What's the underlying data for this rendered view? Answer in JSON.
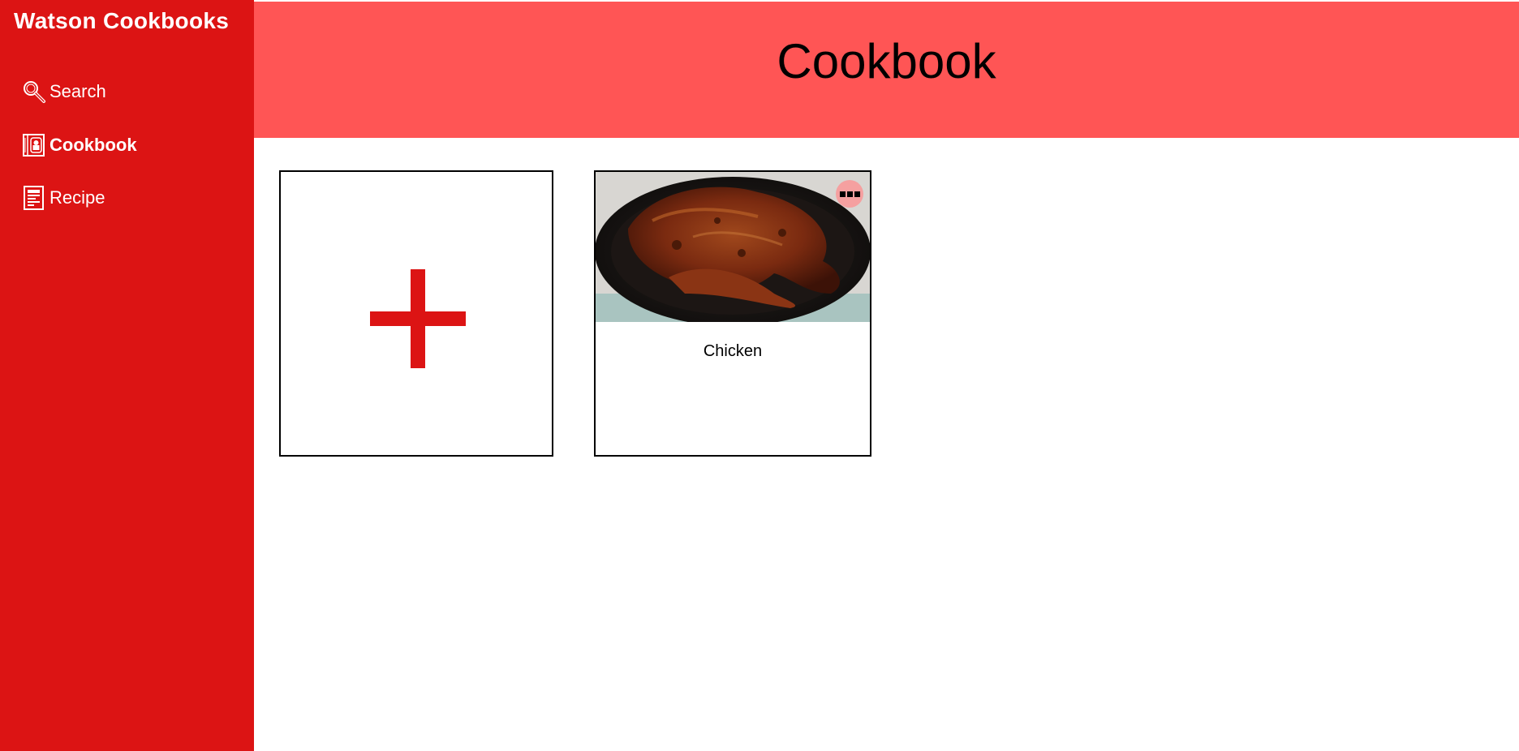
{
  "sidebar": {
    "brand": "Watson Cookbooks",
    "items": [
      {
        "label": "Search",
        "icon": "search-icon",
        "active": false
      },
      {
        "label": "Cookbook",
        "icon": "cookbook-icon",
        "active": true
      },
      {
        "label": "Recipe",
        "icon": "recipe-icon",
        "active": false
      }
    ]
  },
  "header": {
    "title": "Cookbook"
  },
  "cards": {
    "add_icon": "plus-icon",
    "recipes": [
      {
        "name": "Chicken",
        "image": "roast-chicken-in-skillet",
        "menu_icon": "more-options-icon"
      }
    ]
  },
  "colors": {
    "sidebar": "#dc1414",
    "header": "#ff5555",
    "accent": "#dc1414",
    "menu_button": "#f5a0a0"
  }
}
